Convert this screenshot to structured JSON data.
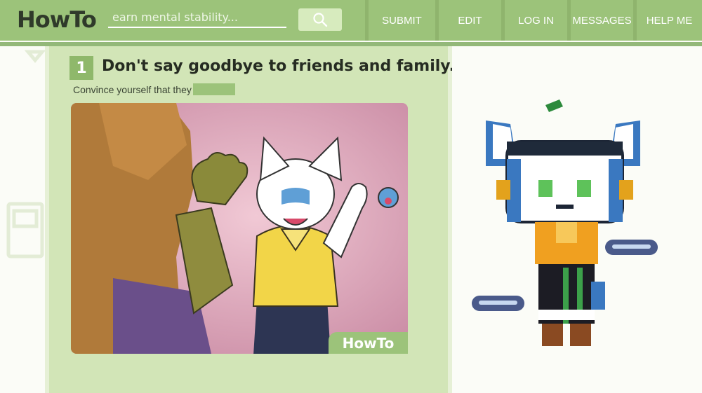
{
  "header": {
    "logo": "HowTo",
    "search": {
      "placeholder": "earn mental stability..."
    },
    "nav": [
      {
        "label": "SUBMIT"
      },
      {
        "label": "EDIT"
      },
      {
        "label": "LOG IN"
      },
      {
        "label": "MESSAGES"
      },
      {
        "label": "HELP ME"
      }
    ]
  },
  "step": {
    "number": "1",
    "title": "Don't say goodbye to friends and family.",
    "description": "Convince yourself that they"
  },
  "illustration": {
    "watermark": "HowTo"
  },
  "colors": {
    "header_green": "#9cc37a",
    "panel_green": "#d2e5b7",
    "title_text": "#262c22"
  }
}
